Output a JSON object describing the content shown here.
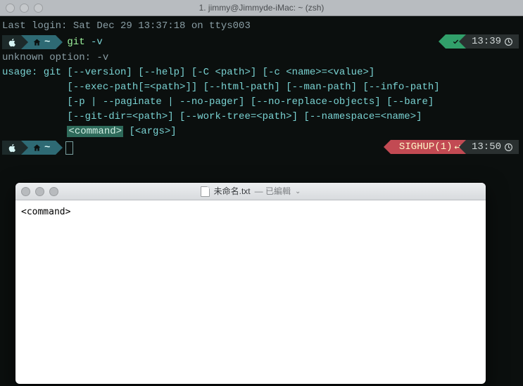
{
  "window_title": "1. jimmy@Jimmyde-iMac: ~ (zsh)",
  "terminal": {
    "last_login": "Last login: Sat Dec 29 13:37:18 on ttys003",
    "prompt1": {
      "tilde": "~",
      "cmd": "git",
      "arg": "-v",
      "time": "13:39"
    },
    "output": {
      "l1": "unknown option: -v",
      "l2": "usage: git [--version] [--help] [-C <path>] [-c <name>=<value>]",
      "l3": "           [--exec-path[=<path>]] [--html-path] [--man-path] [--info-path]",
      "l4": "           [-p | --paginate | --no-pager] [--no-replace-objects] [--bare]",
      "l5": "           [--git-dir=<path>] [--work-tree=<path>] [--namespace=<name>]",
      "l6a": "           ",
      "l6b": "<command>",
      "l6c": " [<args>]"
    },
    "prompt2": {
      "tilde": "~",
      "sighup": "SIGHUP(1)",
      "ret": "↵",
      "time": "13:50"
    }
  },
  "textwin": {
    "filename": "未命名.txt",
    "status": "— 已編輯",
    "content": "<command>"
  }
}
